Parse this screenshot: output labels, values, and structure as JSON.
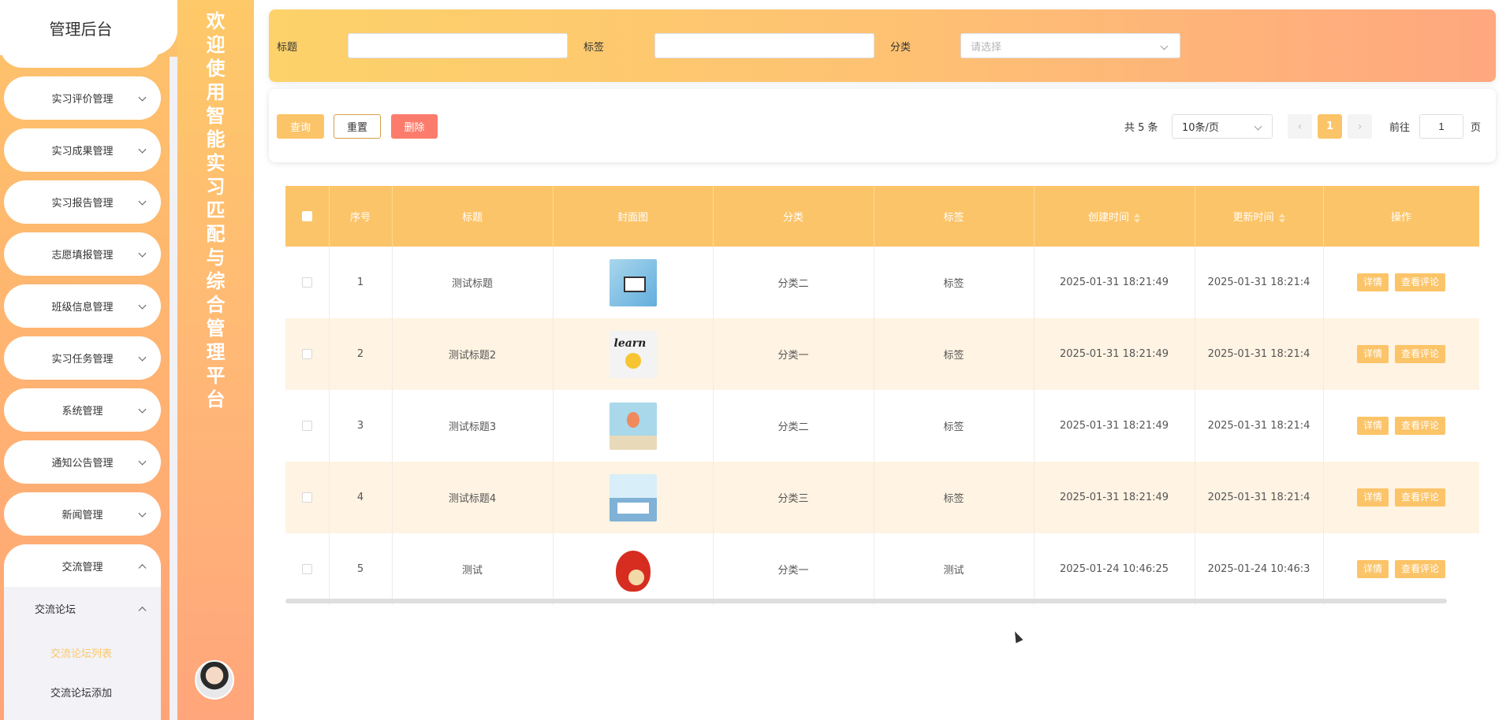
{
  "sidebar": {
    "title": "管理后台",
    "menus": [
      {
        "label": "实习评价管理"
      },
      {
        "label": "实习成果管理"
      },
      {
        "label": "实习报告管理"
      },
      {
        "label": "志愿填报管理"
      },
      {
        "label": "班级信息管理"
      },
      {
        "label": "实习任务管理"
      },
      {
        "label": "系统管理"
      },
      {
        "label": "通知公告管理"
      },
      {
        "label": "新闻管理"
      },
      {
        "label": "交流管理"
      }
    ],
    "submenu": {
      "label": "交流论坛",
      "items": [
        {
          "label": "交流论坛列表",
          "active": true
        },
        {
          "label": "交流论坛添加",
          "active": false
        }
      ]
    }
  },
  "banner": {
    "chars": [
      "欢",
      "迎",
      "使",
      "用",
      "智",
      "能",
      "实",
      "习",
      "匹",
      "配",
      "与",
      "综",
      "合",
      "管",
      "理",
      "平",
      "台"
    ]
  },
  "filter": {
    "title_label": "标题",
    "title_value": "",
    "tag_label": "标签",
    "tag_value": "",
    "category_label": "分类",
    "category_placeholder": "请选择"
  },
  "actions": {
    "query_label": "查询",
    "reset_label": "重置",
    "delete_label": "删除"
  },
  "pagination": {
    "total_text": "共 5 条",
    "page_size": "10条/页",
    "prev_icon": "‹",
    "next_icon": "›",
    "current_page": "1",
    "goto_prefix": "前往",
    "goto_value": "1",
    "goto_suffix": "页"
  },
  "table": {
    "headers": {
      "index": "序号",
      "title": "标题",
      "cover": "封面图",
      "category": "分类",
      "tag": "标签",
      "created": "创建时间",
      "updated": "更新时间",
      "ops": "操作"
    },
    "op_labels": {
      "detail": "详情",
      "comments": "查看评论"
    },
    "rows": [
      {
        "index": "1",
        "title": "测试标题",
        "cover": "thumb-computer",
        "category": "分类二",
        "tag": "标签",
        "created": "2025-01-31 18:21:49",
        "updated": "2025-01-31 18:21:4"
      },
      {
        "index": "2",
        "title": "测试标题2",
        "cover": "thumb-learn",
        "category": "分类一",
        "tag": "标签",
        "created": "2025-01-31 18:21:49",
        "updated": "2025-01-31 18:21:4"
      },
      {
        "index": "3",
        "title": "测试标题3",
        "cover": "thumb-book-balloon",
        "category": "分类二",
        "tag": "标签",
        "created": "2025-01-31 18:21:49",
        "updated": "2025-01-31 18:21:4"
      },
      {
        "index": "4",
        "title": "测试标题4",
        "cover": "thumb-book-city",
        "category": "分类三",
        "tag": "标签",
        "created": "2025-01-31 18:21:49",
        "updated": "2025-01-31 18:21:4"
      },
      {
        "index": "5",
        "title": "测试",
        "cover": "thumb-red-bird",
        "category": "分类一",
        "tag": "测试",
        "created": "2025-01-24 10:46:25",
        "updated": "2025-01-24 10:46:3"
      }
    ]
  },
  "colors": {
    "accent": "#fcc468",
    "danger": "#fb7c6c",
    "stripe": "#fff3e3"
  }
}
